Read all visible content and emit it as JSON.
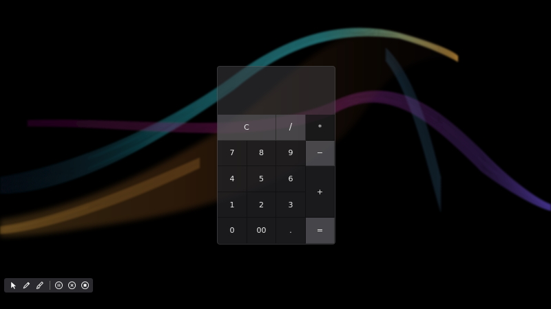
{
  "calculator": {
    "display_value": "",
    "keys": {
      "clear": "C",
      "divide": "/",
      "multiply": "*",
      "minus": "−",
      "plus": "+",
      "equals": "=",
      "seven": "7",
      "eight": "8",
      "nine": "9",
      "four": "4",
      "five": "5",
      "six": "6",
      "one": "1",
      "two": "2",
      "three": "3",
      "zero": "0",
      "double_zero": "00",
      "decimal": "."
    }
  },
  "toolbar": {
    "items": [
      {
        "icon": "pointer-icon"
      },
      {
        "icon": "pen-icon"
      },
      {
        "icon": "brush-icon"
      },
      {
        "icon": "pause-icon"
      },
      {
        "icon": "close-circle-icon"
      },
      {
        "icon": "stop-icon"
      }
    ]
  },
  "colors": {
    "background": "#000000",
    "wave_cyan": "#27b7c9",
    "wave_magenta": "#c2228f",
    "wave_orange": "#e0a040",
    "wave_violet": "#7a5cff"
  }
}
